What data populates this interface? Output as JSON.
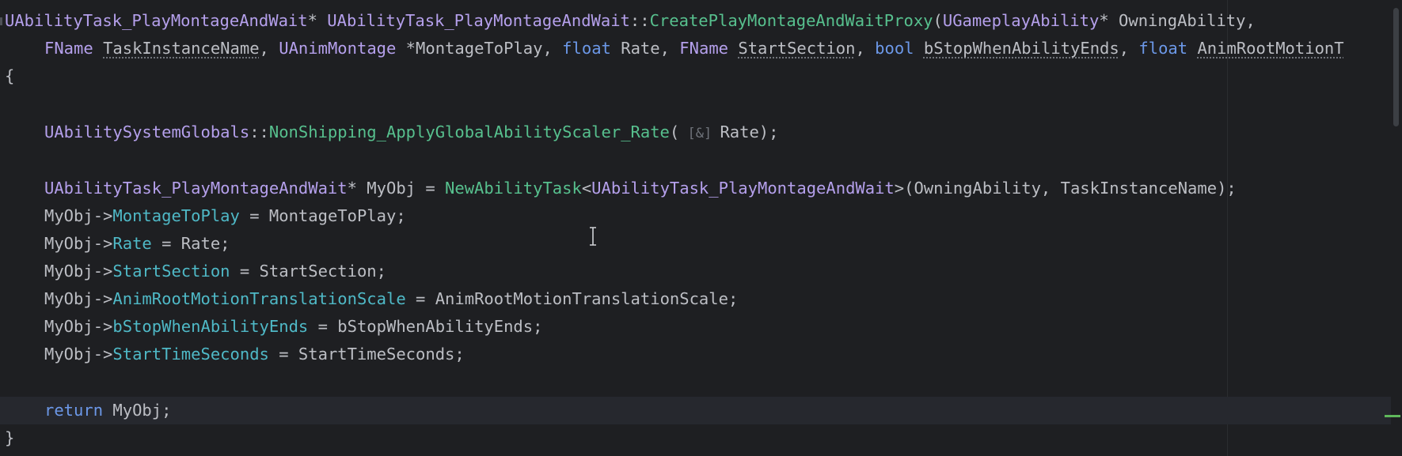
{
  "editor": {
    "theme": {
      "background": "#1e1f22",
      "class_color": "#b5a0ec",
      "function_color": "#57c08e",
      "keyword_color": "#6c98e8",
      "field_color": "#4fb9c7",
      "text_color": "#bcbec4"
    },
    "lines": {
      "l1": {
        "ret_type": "UAbilityTask_PlayMontageAndWait",
        "ptr": "* ",
        "cls": "UAbilityTask_PlayMontageAndWait",
        "scope": "::",
        "func": "CreatePlayMontageAndWaitProxy",
        "open": "(",
        "param_type": "UGameplayAbility",
        "rest": "* OwningAbility,"
      },
      "l2": {
        "t1": "FName",
        "p1": "TaskInstanceName",
        "c1": ", ",
        "t2": "UAnimMontage",
        "p2": " *MontageToPlay, ",
        "t3": "float",
        "p3": " Rate, ",
        "t4": "FName",
        "p4": "StartSection",
        "c4": ", ",
        "t5": "bool",
        "p5": "bStopWhenAbilityEnds",
        "c5": ", ",
        "t6": "float",
        "p6": "AnimRootMotionT"
      },
      "l3": {
        "text": "{"
      },
      "l4": {
        "cls": "UAbilitySystemGlobals",
        "scope": "::",
        "func": "NonShipping_ApplyGlobalAbilityScaler_Rate",
        "open": "(",
        "hint": " [&] ",
        "rest": "Rate);"
      },
      "l5": {
        "cls": "UAbilityTask_PlayMontageAndWait",
        "mid": "* MyObj = ",
        "func": "NewAbilityTask",
        "lt": "<",
        "tmpl": "UAbilityTask_PlayMontageAndWait",
        "rest": ">(OwningAbility, TaskInstanceName);"
      },
      "l6": {
        "obj": "MyObj->",
        "field": "MontageToPlay",
        "rest": " = MontageToPlay;"
      },
      "l7": {
        "obj": "MyObj->",
        "field": "Rate",
        "rest": " = Rate;"
      },
      "l8": {
        "obj": "MyObj->",
        "field": "StartSection",
        "rest": " = StartSection;"
      },
      "l9": {
        "obj": "MyObj->",
        "field": "AnimRootMotionTranslationScale",
        "rest": " = AnimRootMotionTranslationScale;"
      },
      "l10": {
        "obj": "MyObj->",
        "field": "bStopWhenAbilityEnds",
        "rest": " = bStopWhenAbilityEnds;"
      },
      "l11": {
        "obj": "MyObj->",
        "field": "StartTimeSeconds",
        "rest": " = StartTimeSeconds;"
      },
      "l12": {
        "kw": "return",
        "rest": " MyObj;"
      },
      "l13": {
        "text": "}"
      }
    }
  }
}
